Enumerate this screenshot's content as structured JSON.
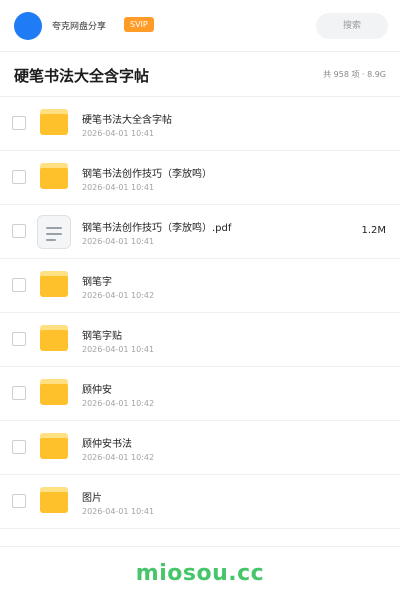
{
  "header": {
    "brand": "夸克网盘分享",
    "badge": "SVIP",
    "search_label": "搜索"
  },
  "title_bar": {
    "title": "硬笔书法大全含字帖",
    "summary": "共 958 项 · 8.9G"
  },
  "files": [
    {
      "name": "硬笔书法大全含字帖",
      "date": "2026-04-01 10:41",
      "type": "folder",
      "size": ""
    },
    {
      "name": "钢笔书法创作技巧（李放鸣）",
      "date": "2026-04-01 10:41",
      "type": "folder",
      "size": ""
    },
    {
      "name": "钢笔书法创作技巧（李放鸣）.pdf",
      "date": "2026-04-01 10:41",
      "type": "document",
      "size": "1.2M"
    },
    {
      "name": "钢笔字",
      "date": "2026-04-01 10:42",
      "type": "folder",
      "size": ""
    },
    {
      "name": "钢笔字贴",
      "date": "2026-04-01 10:41",
      "type": "folder",
      "size": ""
    },
    {
      "name": "顾仲安",
      "date": "2026-04-01 10:42",
      "type": "folder",
      "size": ""
    },
    {
      "name": "顾仲安书法",
      "date": "2026-04-01 10:42",
      "type": "folder",
      "size": ""
    },
    {
      "name": "图片",
      "date": "2026-04-01 10:41",
      "type": "folder",
      "size": ""
    }
  ],
  "footer": {
    "watermark": "miosou.cc"
  },
  "colors": {
    "accent": "#1f7cf5",
    "svip": "#ff9b27",
    "folder": "#ffc12b",
    "watermark": "#47c56a"
  }
}
